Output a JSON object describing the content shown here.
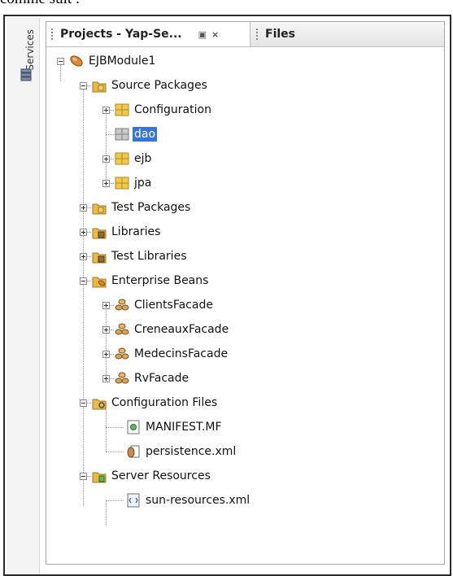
{
  "caption": "comme suit :",
  "sidebar": {
    "services_label": "Services"
  },
  "tabs": [
    {
      "label": "Projects - Yap-Se...",
      "active": true
    },
    {
      "label": "Files",
      "active": false
    }
  ],
  "tab_controls": {
    "minimize": "▣",
    "close": "⨯"
  },
  "tree": {
    "root": "EJBModule1",
    "source_packages": "Source Packages",
    "pkg_configuration": "Configuration",
    "pkg_dao": "dao",
    "pkg_ejb": "ejb",
    "pkg_jpa": "jpa",
    "test_packages": "Test Packages",
    "libraries": "Libraries",
    "test_libraries": "Test Libraries",
    "enterprise_beans": "Enterprise Beans",
    "bean_clients": "ClientsFacade",
    "bean_creneaux": "CreneauxFacade",
    "bean_medecins": "MedecinsFacade",
    "bean_rv": "RvFacade",
    "configuration_files": "Configuration Files",
    "file_manifest": "MANIFEST.MF",
    "file_persistence": "persistence.xml",
    "server_resources": "Server Resources",
    "file_sun_resources": "sun-resources.xml"
  },
  "selected_node": "dao",
  "colors": {
    "selection": "#3875d7",
    "package": "#f2c94c",
    "folder": "#e8b84a"
  }
}
